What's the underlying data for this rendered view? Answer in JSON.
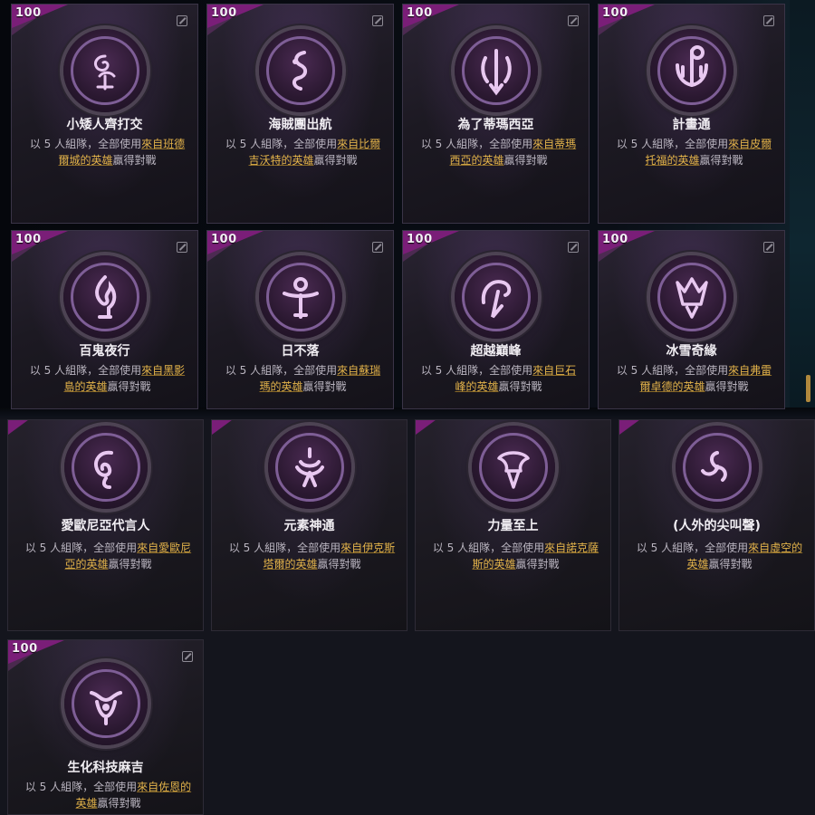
{
  "badge_value": "100",
  "desc_prefix": "以 5 人組隊，全部使用",
  "desc_suffix": "贏得對戰",
  "colors": {
    "accent_link": "#e3b34a",
    "corner": "#7a1e78",
    "emblem_ring": "#7e5e96"
  },
  "cards": [
    {
      "title": "小矮人齊打交",
      "link": "來自班德爾城的英雄",
      "icon": "swirl-rose-icon"
    },
    {
      "title": "海賊團出航",
      "link": "來自比爾吉沃特的英雄",
      "icon": "serpent-icon"
    },
    {
      "title": "為了蒂瑪西亞",
      "link": "來自蒂瑪西亞的英雄",
      "icon": "wings-sword-icon"
    },
    {
      "title": "計畫通",
      "link": "來自皮爾托福的英雄",
      "icon": "gear-icon"
    },
    {
      "title": "百鬼夜行",
      "link": "來自黑影島的英雄",
      "icon": "flame-icon"
    },
    {
      "title": "日不落",
      "link": "來自蘇瑞瑪的英雄",
      "icon": "sun-disc-icon"
    },
    {
      "title": "超越巔峰",
      "link": "來自巨石峰的英雄",
      "icon": "crescent-peak-icon"
    },
    {
      "title": "冰雪奇緣",
      "link": "來自弗雷爾卓德的英雄",
      "icon": "ice-crown-icon"
    },
    {
      "title": "愛歐尼亞代言人",
      "link": "來自愛歐尼亞的英雄",
      "icon": "spiral-leaf-icon"
    },
    {
      "title": "元素神通",
      "link": "來自伊克斯塔爾的英雄",
      "icon": "blossom-icon"
    },
    {
      "title": "力量至上",
      "link": "來自諾克薩斯的英雄",
      "icon": "axe-helm-icon"
    },
    {
      "title": "(人外的尖叫聲)",
      "link": "來自虛空的英雄",
      "icon": "void-triskelion-icon"
    },
    {
      "title": "生化科技麻吉",
      "link": "來自佐恩的英雄",
      "icon": "chemtech-crest-icon"
    }
  ]
}
